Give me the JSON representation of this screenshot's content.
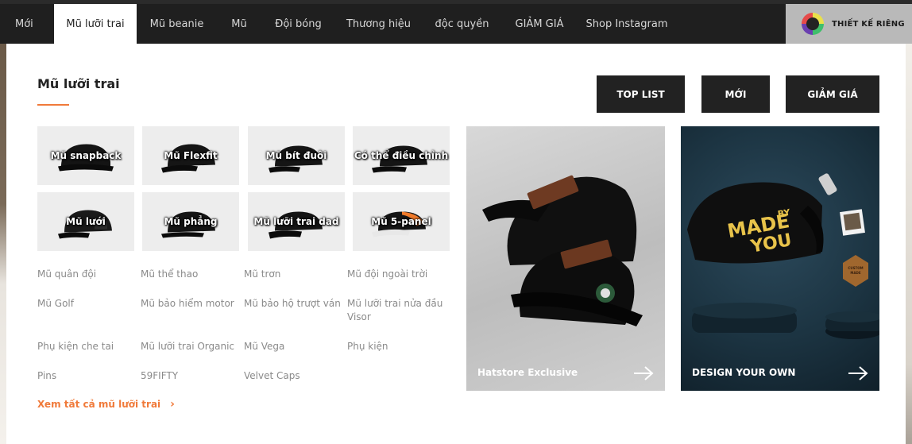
{
  "nav": {
    "items": [
      "Mới",
      "Mũ lưỡi trai",
      "Mũ beanie",
      "Mũ",
      "Đội bóng",
      "Thương hiệu",
      "độc quyền",
      "GIẢM GIÁ",
      "Shop Instagram"
    ],
    "custom_label": "THIẾT KẾ RIÊNG"
  },
  "panel": {
    "title": "Mũ lưỡi trai",
    "buttons": [
      "TOP LIST",
      "MỚI",
      "GIẢM GIÁ"
    ],
    "tiles": [
      "Mũ snapback",
      "Mũ Flexfit",
      "Mũ bít đuôi",
      "Có thể điều chỉnh",
      "Mũ lưới",
      "Mũ phẳng",
      "Mũ lưỡi trai dad",
      "Mũ 5-panel"
    ],
    "links": [
      [
        "Mũ quân đội",
        "Mũ thể thao",
        "Mũ trơn",
        "Mũ đội ngoài trời"
      ],
      [
        "Mũ Golf",
        "Mũ bảo hiểm motor",
        "Mũ bảo hộ trượt ván",
        "Mũ lưỡi trai nửa đầu Visor"
      ],
      [
        "Phụ kiện che tai",
        "Mũ lưỡi trai Organic",
        "Mũ Vega",
        "Phụ kiện"
      ],
      [
        "Pins",
        "59FIFTY",
        "Velvet Caps"
      ]
    ],
    "see_all": "Xem tất cả mũ lưỡi trai",
    "promos": [
      {
        "label": "Hatstore Exclusive"
      },
      {
        "label": "DESIGN YOUR OWN",
        "cap_text_1": "MADE",
        "cap_text_2": "BY",
        "cap_text_3": "YOU",
        "badge_text_1": "CUSTOM",
        "badge_text_2": "MADE"
      }
    ]
  },
  "colors": {
    "accent": "#f07a3a",
    "nav_bg": "#1f1f1f",
    "button_bg": "#222222",
    "tile_bg": "#ededed",
    "custom_tab_bg": "#b9b9b9"
  }
}
